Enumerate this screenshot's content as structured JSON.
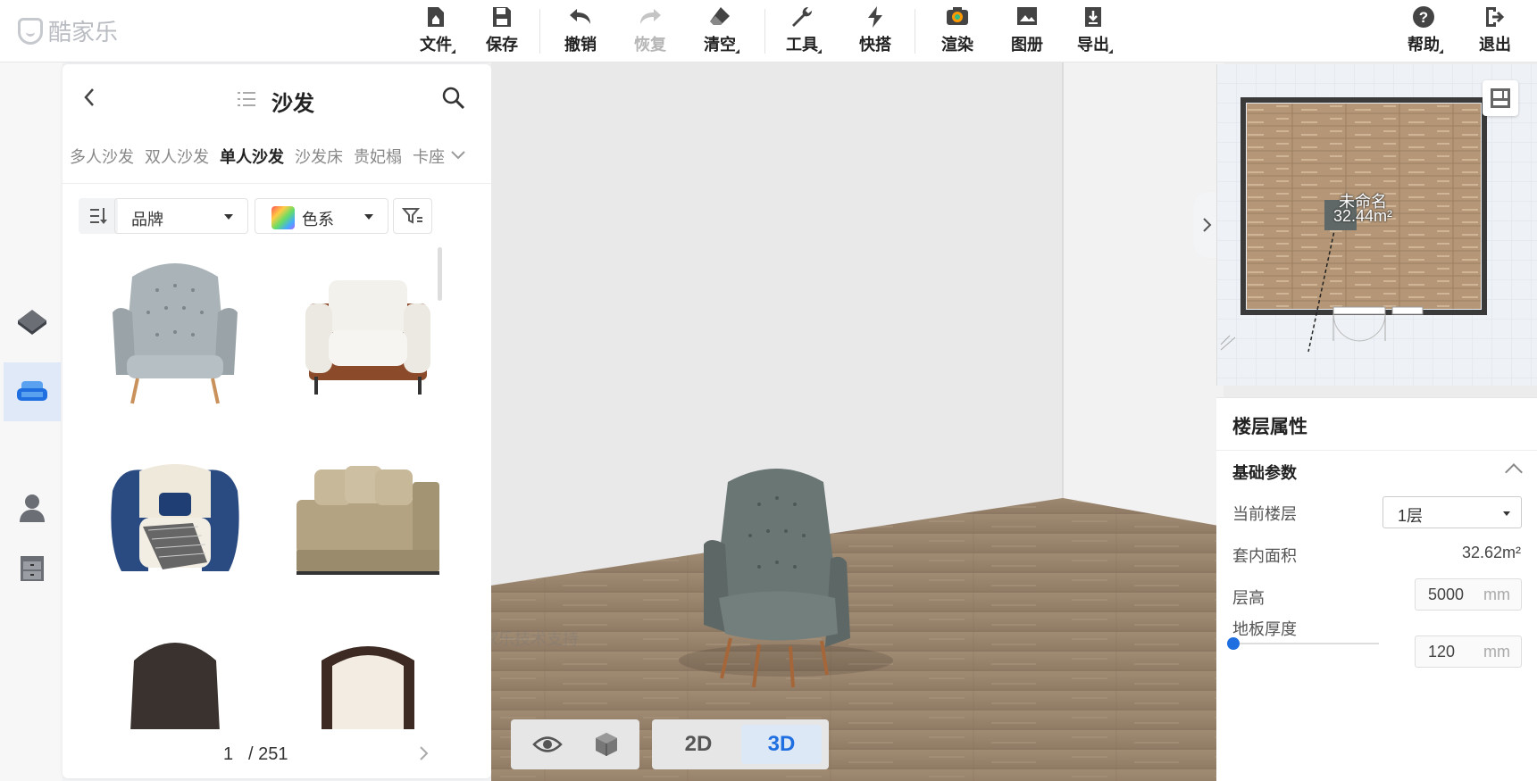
{
  "app": {
    "logo_text": "酷家乐"
  },
  "toolbar": {
    "file": "文件",
    "save": "保存",
    "undo": "撤销",
    "redo": "恢复",
    "clear": "清空",
    "tools": "工具",
    "quick": "快搭",
    "render": "渲染",
    "album": "图册",
    "export": "导出",
    "help": "帮助",
    "logout": "退出"
  },
  "catalog": {
    "title": "沙发",
    "tabs": [
      "多人沙发",
      "双人沙发",
      "单人沙发",
      "沙发床",
      "贵妃榻",
      "卡座"
    ],
    "active_tab": "单人沙发",
    "brand_label": "品牌",
    "color_label": "色系",
    "page_current": "1",
    "page_total": "/ 251"
  },
  "viewport": {
    "watermark": "酷家乐技术支持",
    "mode_2d": "2D",
    "mode_3d": "3D",
    "active_mode": "3D"
  },
  "minimap": {
    "room_name": "未命名",
    "room_area": "32.44m²"
  },
  "properties": {
    "title": "楼层属性",
    "section": "基础参数",
    "current_floor_label": "当前楼层",
    "current_floor_value": "1层",
    "inner_area_label": "套内面积",
    "inner_area_value": "32.62m²",
    "floor_height_label": "层高",
    "floor_height_value": "5000",
    "floor_height_unit": "mm",
    "slab_thickness_label": "地板厚度",
    "slab_thickness_value": "120",
    "slab_thickness_unit": "mm"
  },
  "colors": {
    "accent": "#1f6fe0",
    "active_rail": "#dfe9f8"
  }
}
